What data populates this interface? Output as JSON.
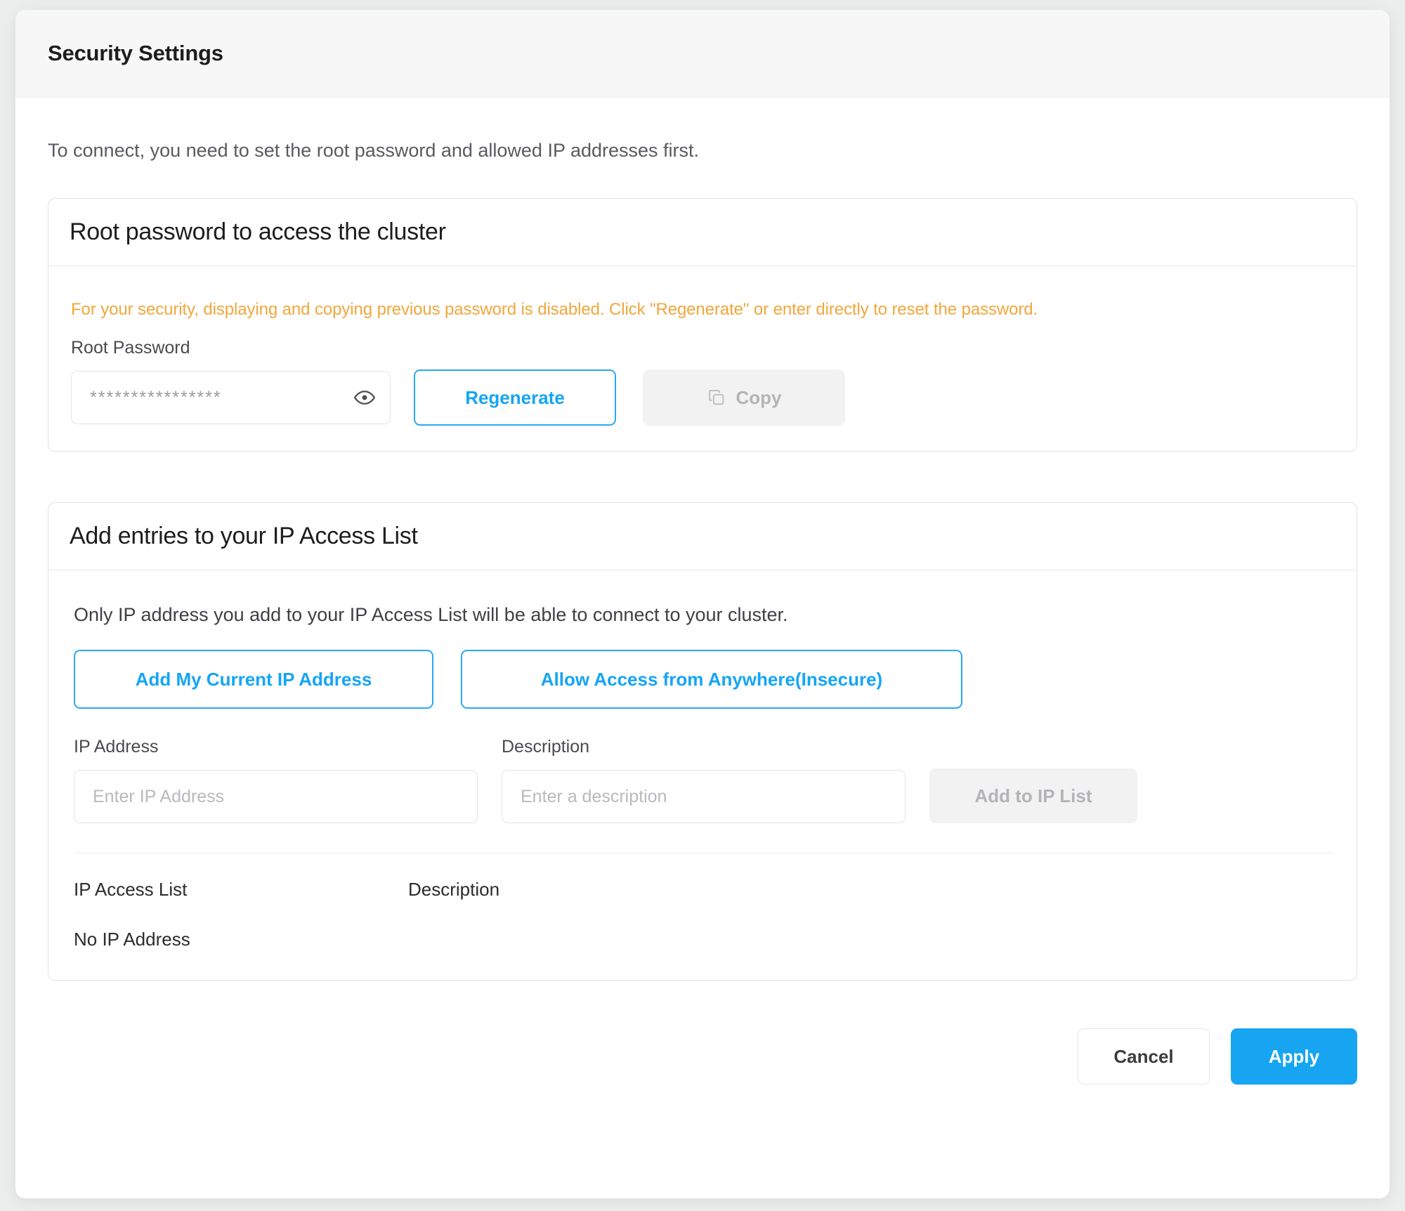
{
  "modal": {
    "title": "Security Settings",
    "intro": "To connect, you need to set the root password and allowed IP addresses first."
  },
  "password_card": {
    "header": "Root password to access the cluster",
    "warning": "For your security, displaying and copying previous password is disabled. Click \"Regenerate\" or enter directly to reset the password.",
    "field_label": "Root Password",
    "password_value": "****************",
    "password_placeholder": "",
    "toggle_icon": "eye-icon",
    "regenerate_label": "Regenerate",
    "copy_label": "Copy",
    "copy_icon": "copy-icon",
    "copy_disabled": true
  },
  "ip_card": {
    "header": "Add entries to your IP Access List",
    "description": "Only IP address you add to your IP Access List will be able to connect to your cluster.",
    "add_current_ip_label": "Add My Current IP Address",
    "allow_anywhere_label": "Allow Access from Anywhere(Insecure)",
    "ip_field_label": "IP Address",
    "ip_placeholder": "Enter IP Address",
    "ip_value": "",
    "description_field_label": "Description",
    "description_placeholder": "Enter a description",
    "description_value": "",
    "add_button_label": "Add to IP List",
    "add_button_disabled": true,
    "list_columns": [
      "IP Access List",
      "Description"
    ],
    "list_empty_text": "No IP Address",
    "list_rows": []
  },
  "footer": {
    "cancel_label": "Cancel",
    "apply_label": "Apply"
  },
  "colors": {
    "accent_blue": "#17a5f2",
    "outline_blue": "#29a8f5",
    "warning_orange": "#f2a73c",
    "disabled_bg": "#f2f2f2",
    "disabled_text": "#b4b4b8",
    "header_bg": "#f7f7f7",
    "page_bg": "#eceded"
  }
}
